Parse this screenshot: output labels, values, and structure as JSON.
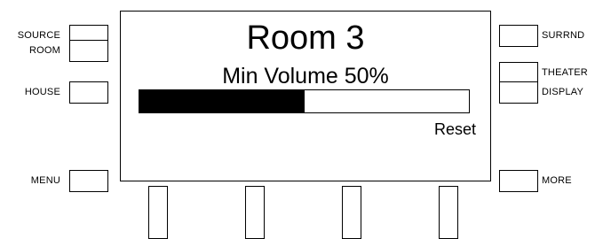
{
  "left_buttons": [
    {
      "label": "SOURCE"
    },
    {
      "label": "ROOM"
    },
    {
      "label": "HOUSE"
    },
    {
      "label": "MENU"
    }
  ],
  "right_buttons": [
    {
      "label": "SURRND"
    },
    {
      "label": "THEATER"
    },
    {
      "label": "DISPLAY"
    },
    {
      "label": "MORE"
    }
  ],
  "screen": {
    "title": "Room 3",
    "status": "Min Volume 50%",
    "volume_fraction": 0.5,
    "reset_label": "Reset"
  }
}
